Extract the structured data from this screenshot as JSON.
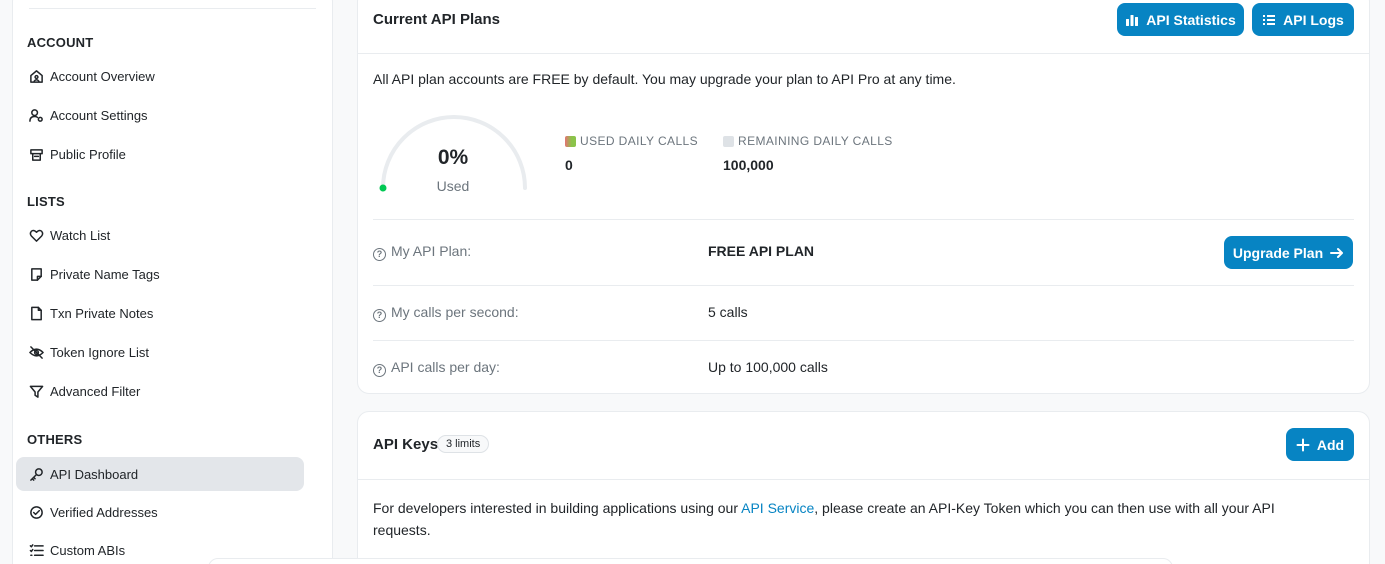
{
  "sidebar": {
    "sections": [
      {
        "title": "ACCOUNT"
      },
      {
        "title": "LISTS"
      },
      {
        "title": "OTHERS"
      }
    ],
    "items": [
      {
        "label": "Account Overview",
        "icon": "home-user-icon"
      },
      {
        "label": "Account Settings",
        "icon": "user-gear-icon"
      },
      {
        "label": "Public Profile",
        "icon": "profile-card-icon"
      },
      {
        "label": "Watch List",
        "icon": "heart-icon"
      },
      {
        "label": "Private Name Tags",
        "icon": "note-icon"
      },
      {
        "label": "Txn Private Notes",
        "icon": "file-icon"
      },
      {
        "label": "Token Ignore List",
        "icon": "eye-slash-icon"
      },
      {
        "label": "Advanced Filter",
        "icon": "filter-icon"
      },
      {
        "label": "API Dashboard",
        "icon": "key-icon",
        "active": true
      },
      {
        "label": "Verified Addresses",
        "icon": "check-circle-icon"
      },
      {
        "label": "Custom ABIs",
        "icon": "list-icon"
      }
    ]
  },
  "plans": {
    "title": "Current API Plans",
    "stats_button": "API Statistics",
    "logs_button": "API Logs",
    "description": "All API plan accounts are FREE by default. You may upgrade your plan to API Pro at any time.",
    "gauge": {
      "percent_text": "0%",
      "used_label": "Used",
      "used_fraction": 0
    },
    "used_label": "USED DAILY CALLS",
    "used_value": "0",
    "remaining_label": "REMAINING DAILY CALLS",
    "remaining_value": "100,000",
    "rows": [
      {
        "label": "My API Plan:",
        "value": "FREE API PLAN"
      },
      {
        "label": "My calls per second:",
        "value": "5 calls"
      },
      {
        "label": "API calls per day:",
        "value": "Up to 100,000 calls"
      }
    ],
    "upgrade_button": "Upgrade Plan"
  },
  "keys": {
    "title": "API Keys",
    "badge": "3 limits",
    "add_button": "Add",
    "desc_prefix": "For developers interested in building applications using our ",
    "desc_link": "API Service",
    "desc_suffix": ", please create an API-Key Token which you can then use with all your API requests."
  },
  "colors": {
    "accent": "#0784c3",
    "gauge_dot": "#00c853",
    "used_swatch": "#8bc34a",
    "remaining_swatch": "#dee2e6"
  }
}
